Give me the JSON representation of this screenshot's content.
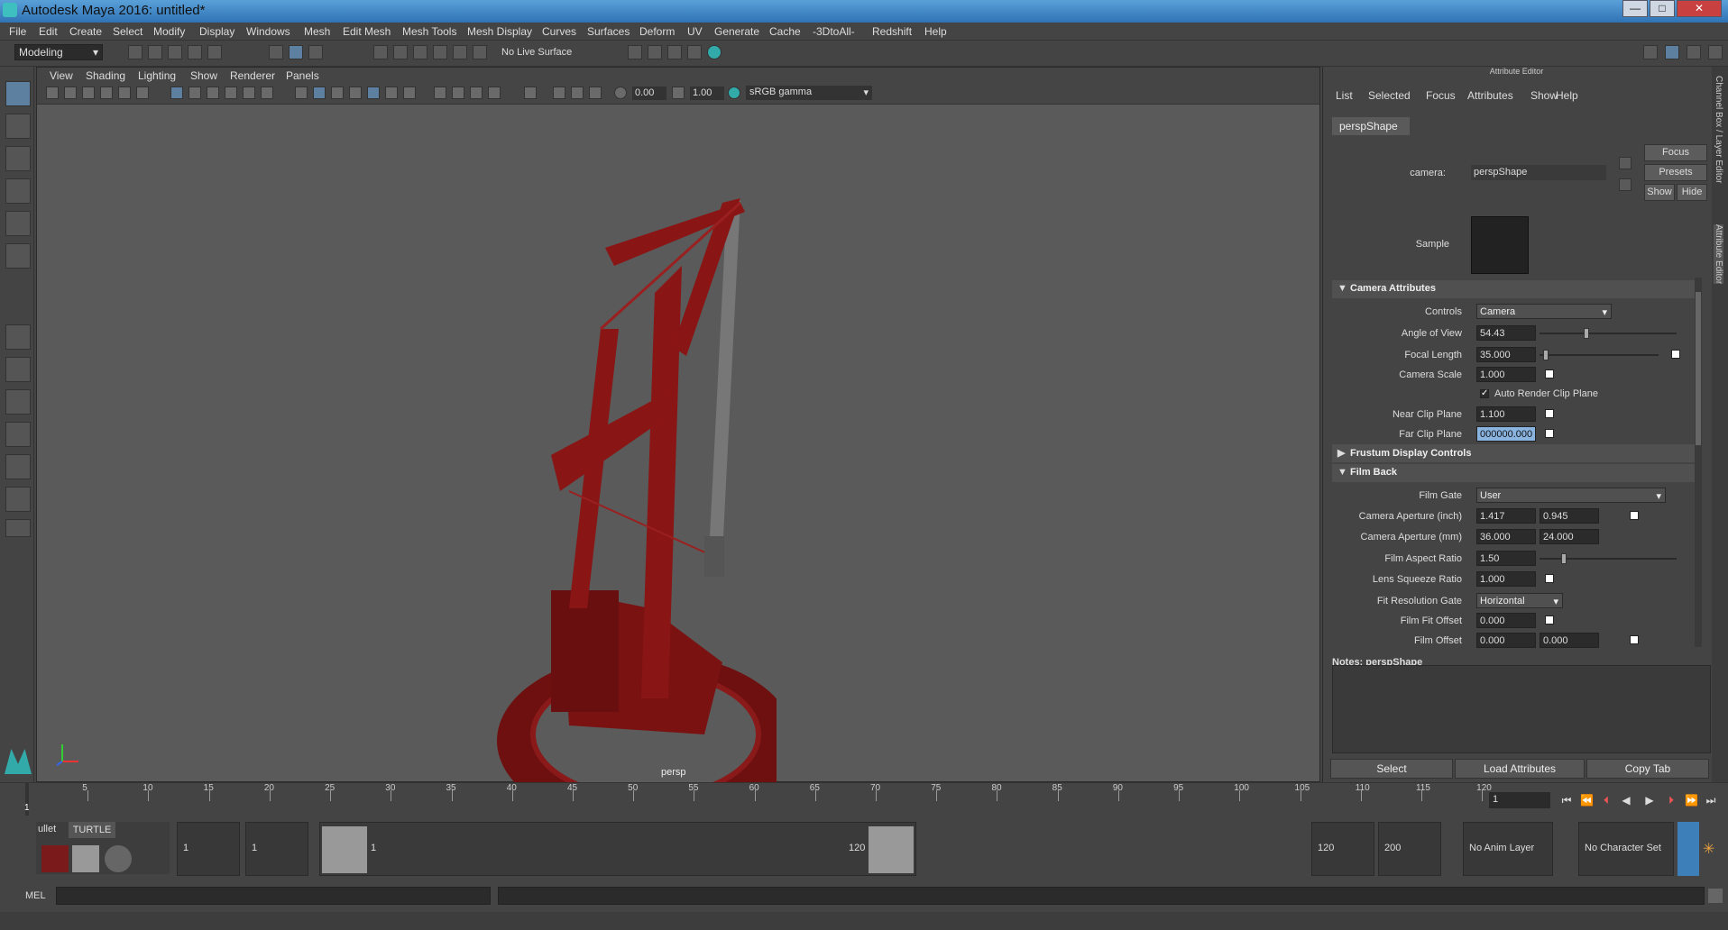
{
  "window": {
    "title": "Autodesk Maya 2016: untitled*",
    "minimize": "—",
    "maximize": "□",
    "close": "✕"
  },
  "menu": [
    "File",
    "Edit",
    "Create",
    "Select",
    "Modify",
    "Display",
    "Windows",
    "Mesh",
    "Edit Mesh",
    "Mesh Tools",
    "Mesh Display",
    "Curves",
    "Surfaces",
    "Deform",
    "UV",
    "Generate",
    "Cache",
    "-3DtoAll-",
    "Redshift",
    "Help"
  ],
  "status": {
    "mode": "Modeling",
    "live_surface": "No Live Surface"
  },
  "viewport": {
    "menu": [
      "View",
      "Shading",
      "Lighting",
      "Show",
      "Renderer",
      "Panels"
    ],
    "exposure": "0.00",
    "gamma": "1.00",
    "color_space": "sRGB gamma",
    "camera_label": "persp"
  },
  "attribute_editor": {
    "title": "Attribute Editor",
    "menu": [
      "List",
      "Selected",
      "Focus",
      "Attributes",
      "Show",
      "Help"
    ],
    "tab": "perspShape",
    "camera_label": "camera:",
    "camera_value": "perspShape",
    "buttons": {
      "focus": "Focus",
      "presets": "Presets",
      "show": "Show",
      "hide": "Hide"
    },
    "sample_label": "Sample",
    "sections": {
      "camera_attributes": "Camera Attributes",
      "frustum": "Frustum Display Controls",
      "film_back": "Film Back"
    },
    "camera_attrs": {
      "controls_label": "Controls",
      "controls_value": "Camera",
      "aov_label": "Angle of View",
      "aov_value": "54.43",
      "focal_label": "Focal Length",
      "focal_value": "35.000",
      "scale_label": "Camera Scale",
      "scale_value": "1.000",
      "auto_clip_label": "Auto Render Clip Plane",
      "near_label": "Near Clip Plane",
      "near_value": "1.100",
      "far_label": "Far Clip Plane",
      "far_value": "000000.000"
    },
    "film_back": {
      "gate_label": "Film Gate",
      "gate_value": "User",
      "ap_inch_label": "Camera Aperture (inch)",
      "ap_inch_x": "1.417",
      "ap_inch_y": "0.945",
      "ap_mm_label": "Camera Aperture (mm)",
      "ap_mm_x": "36.000",
      "ap_mm_y": "24.000",
      "aspect_label": "Film Aspect Ratio",
      "aspect_value": "1.50",
      "squeeze_label": "Lens Squeeze Ratio",
      "squeeze_value": "1.000",
      "fit_label": "Fit Resolution Gate",
      "fit_value": "Horizontal",
      "fit_offset_label": "Film Fit Offset",
      "fit_offset_value": "0.000",
      "offset_label": "Film Offset",
      "offset_x": "0.000",
      "offset_y": "0.000"
    },
    "notes_label": "Notes:  perspShape",
    "bottom": {
      "select": "Select",
      "load": "Load Attributes",
      "copy": "Copy Tab"
    }
  },
  "side_tabs": [
    "Channel Box / Layer Editor",
    "Attribute Editor"
  ],
  "timeline": {
    "ticks": [
      "5",
      "10",
      "15",
      "20",
      "25",
      "30",
      "35",
      "40",
      "45",
      "50",
      "55",
      "60",
      "65",
      "70",
      "75",
      "80",
      "85",
      "90",
      "95",
      "100",
      "105",
      "110",
      "115",
      "120"
    ],
    "start_marker": "1",
    "current_frame": "1"
  },
  "range": {
    "shelf_tabs": [
      "ullet",
      "TURTLE"
    ],
    "start": "1",
    "anim_start": "1",
    "range_start": "1",
    "range_end": "120",
    "anim_end": "120",
    "end": "200",
    "anim_layer": "No Anim Layer",
    "char_set": "No Character Set"
  },
  "command": {
    "label": "MEL"
  }
}
